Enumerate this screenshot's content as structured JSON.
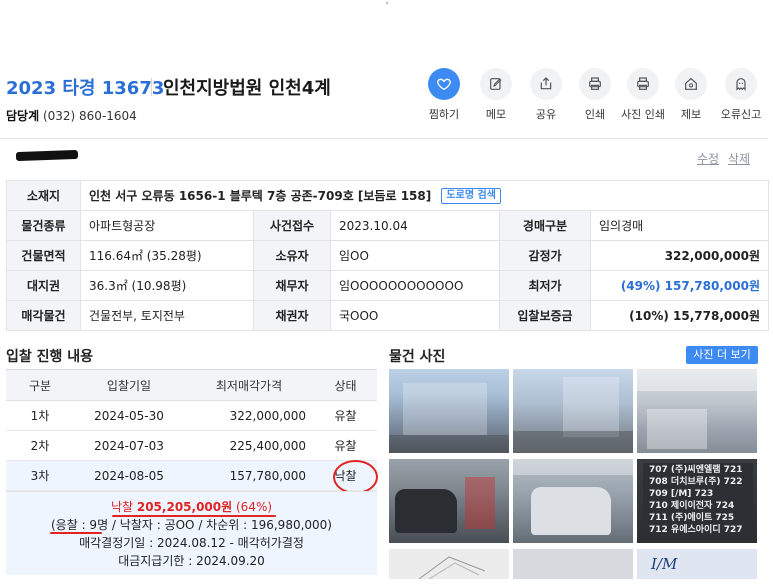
{
  "header": {
    "case_number": "2023 타경 13673",
    "court": "인천지방법원 인천4계",
    "contact_label": "담당계",
    "contact_phone": "(032) 860-1604"
  },
  "actions": [
    {
      "icon": "heart-icon",
      "label": "찜하기"
    },
    {
      "icon": "memo-icon",
      "label": "메모"
    },
    {
      "icon": "share-icon",
      "label": "공유"
    },
    {
      "icon": "printer-icon",
      "label": "인쇄"
    },
    {
      "icon": "printer-icon",
      "label": "사진 인쇄"
    },
    {
      "icon": "home-icon",
      "label": "제보"
    },
    {
      "icon": "ghost-icon",
      "label": "오류신고"
    }
  ],
  "owner": {
    "edit": "수정",
    "delete": "삭제"
  },
  "info": {
    "location_label": "소재지",
    "location_value": "인천 서구 오류동 1656-1 블루텍 7층 공존-709호 [보듬로 158]",
    "road_search": "도로명 검색",
    "rows": [
      {
        "k1": "물건종류",
        "v1": "아파트형공장",
        "k2": "사건접수",
        "v2": "2023.10.04",
        "k3": "경매구분",
        "v3": "임의경매"
      },
      {
        "k1": "건물면적",
        "v1": "116.64㎡ (35.28평)",
        "k2": "소유자",
        "v2": "임OO",
        "k3": "감정가",
        "v3": "322,000,000원"
      },
      {
        "k1": "대지권",
        "v1": "36.3㎡ (10.98평)",
        "k2": "채무자",
        "v2": "임OOOOOOOOOOOO",
        "k3": "최저가",
        "v3": "(49%) 157,780,000원"
      },
      {
        "k1": "매각물건",
        "v1": "건물전부, 토지전부",
        "k2": "채권자",
        "v2": "국OOO",
        "k3": "입찰보증금",
        "v3": "(10%) 15,778,000원"
      }
    ]
  },
  "bids": {
    "title": "입찰 진행 내용",
    "headers": [
      "구분",
      "입찰기일",
      "최저매각가격",
      "상태"
    ],
    "rows": [
      {
        "round": "1차",
        "date": "2024-05-30",
        "price": "322,000,000",
        "status": "유찰"
      },
      {
        "round": "2차",
        "date": "2024-07-03",
        "price": "225,400,000",
        "status": "유찰"
      },
      {
        "round": "3차",
        "date": "2024-08-05",
        "price": "157,780,000",
        "status": "낙찰"
      }
    ],
    "result_prefix": "낙찰",
    "result_amount": "205,205,000원",
    "result_ratio": "(64%)",
    "bidders": "(응찰 : 9명 / 낙찰자 : 공OO / 차순위 : 196,980,000)",
    "decision": "매각결정기일 : 2024.08.12 - 매각허가결정",
    "payment": "대금지급기한 : 2024.09.20"
  },
  "photos": {
    "title": "물건 사진",
    "more": "사진 더 보기",
    "sign_lines": [
      "707 (주)씨엔엘램 721",
      "708 더치브루(주) 722",
      "709 [/M] 723",
      "710 제이이전자 724",
      "711 (주)에이트 725",
      "712 유에스아이디 727"
    ],
    "logo_text": "I/M"
  }
}
